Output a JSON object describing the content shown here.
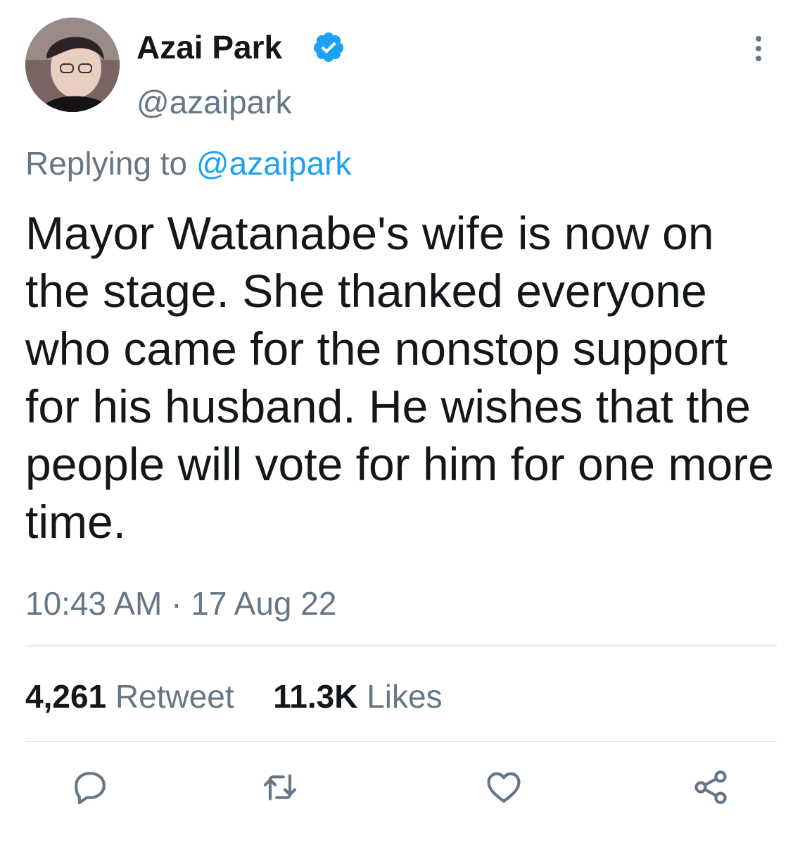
{
  "author": {
    "display_name": "Azai Park",
    "handle": "@azaipark",
    "verified": true
  },
  "reply": {
    "prefix": "Replying to",
    "mention": "@azaipark"
  },
  "tweet": {
    "text": "Mayor Watanabe's wife is now on the stage. She thanked everyone who came for the nonstop support for his husband. He wishes that the people will vote for him for one more time.",
    "timestamp": "10:43 AM · 17 Aug 22"
  },
  "stats": {
    "retweets_count": "4,261",
    "retweets_label": "Retweet",
    "likes_count": "11.3K",
    "likes_label": "Likes"
  },
  "icons": {
    "verified": "verified-badge-icon",
    "more": "more-vertical-icon",
    "reply": "reply-icon",
    "retweet": "retweet-icon",
    "like": "heart-icon",
    "share": "share-icon"
  },
  "colors": {
    "text": "#14171a",
    "muted": "#657786",
    "accent": "#1da1f2",
    "divider": "#e1e8ed"
  }
}
